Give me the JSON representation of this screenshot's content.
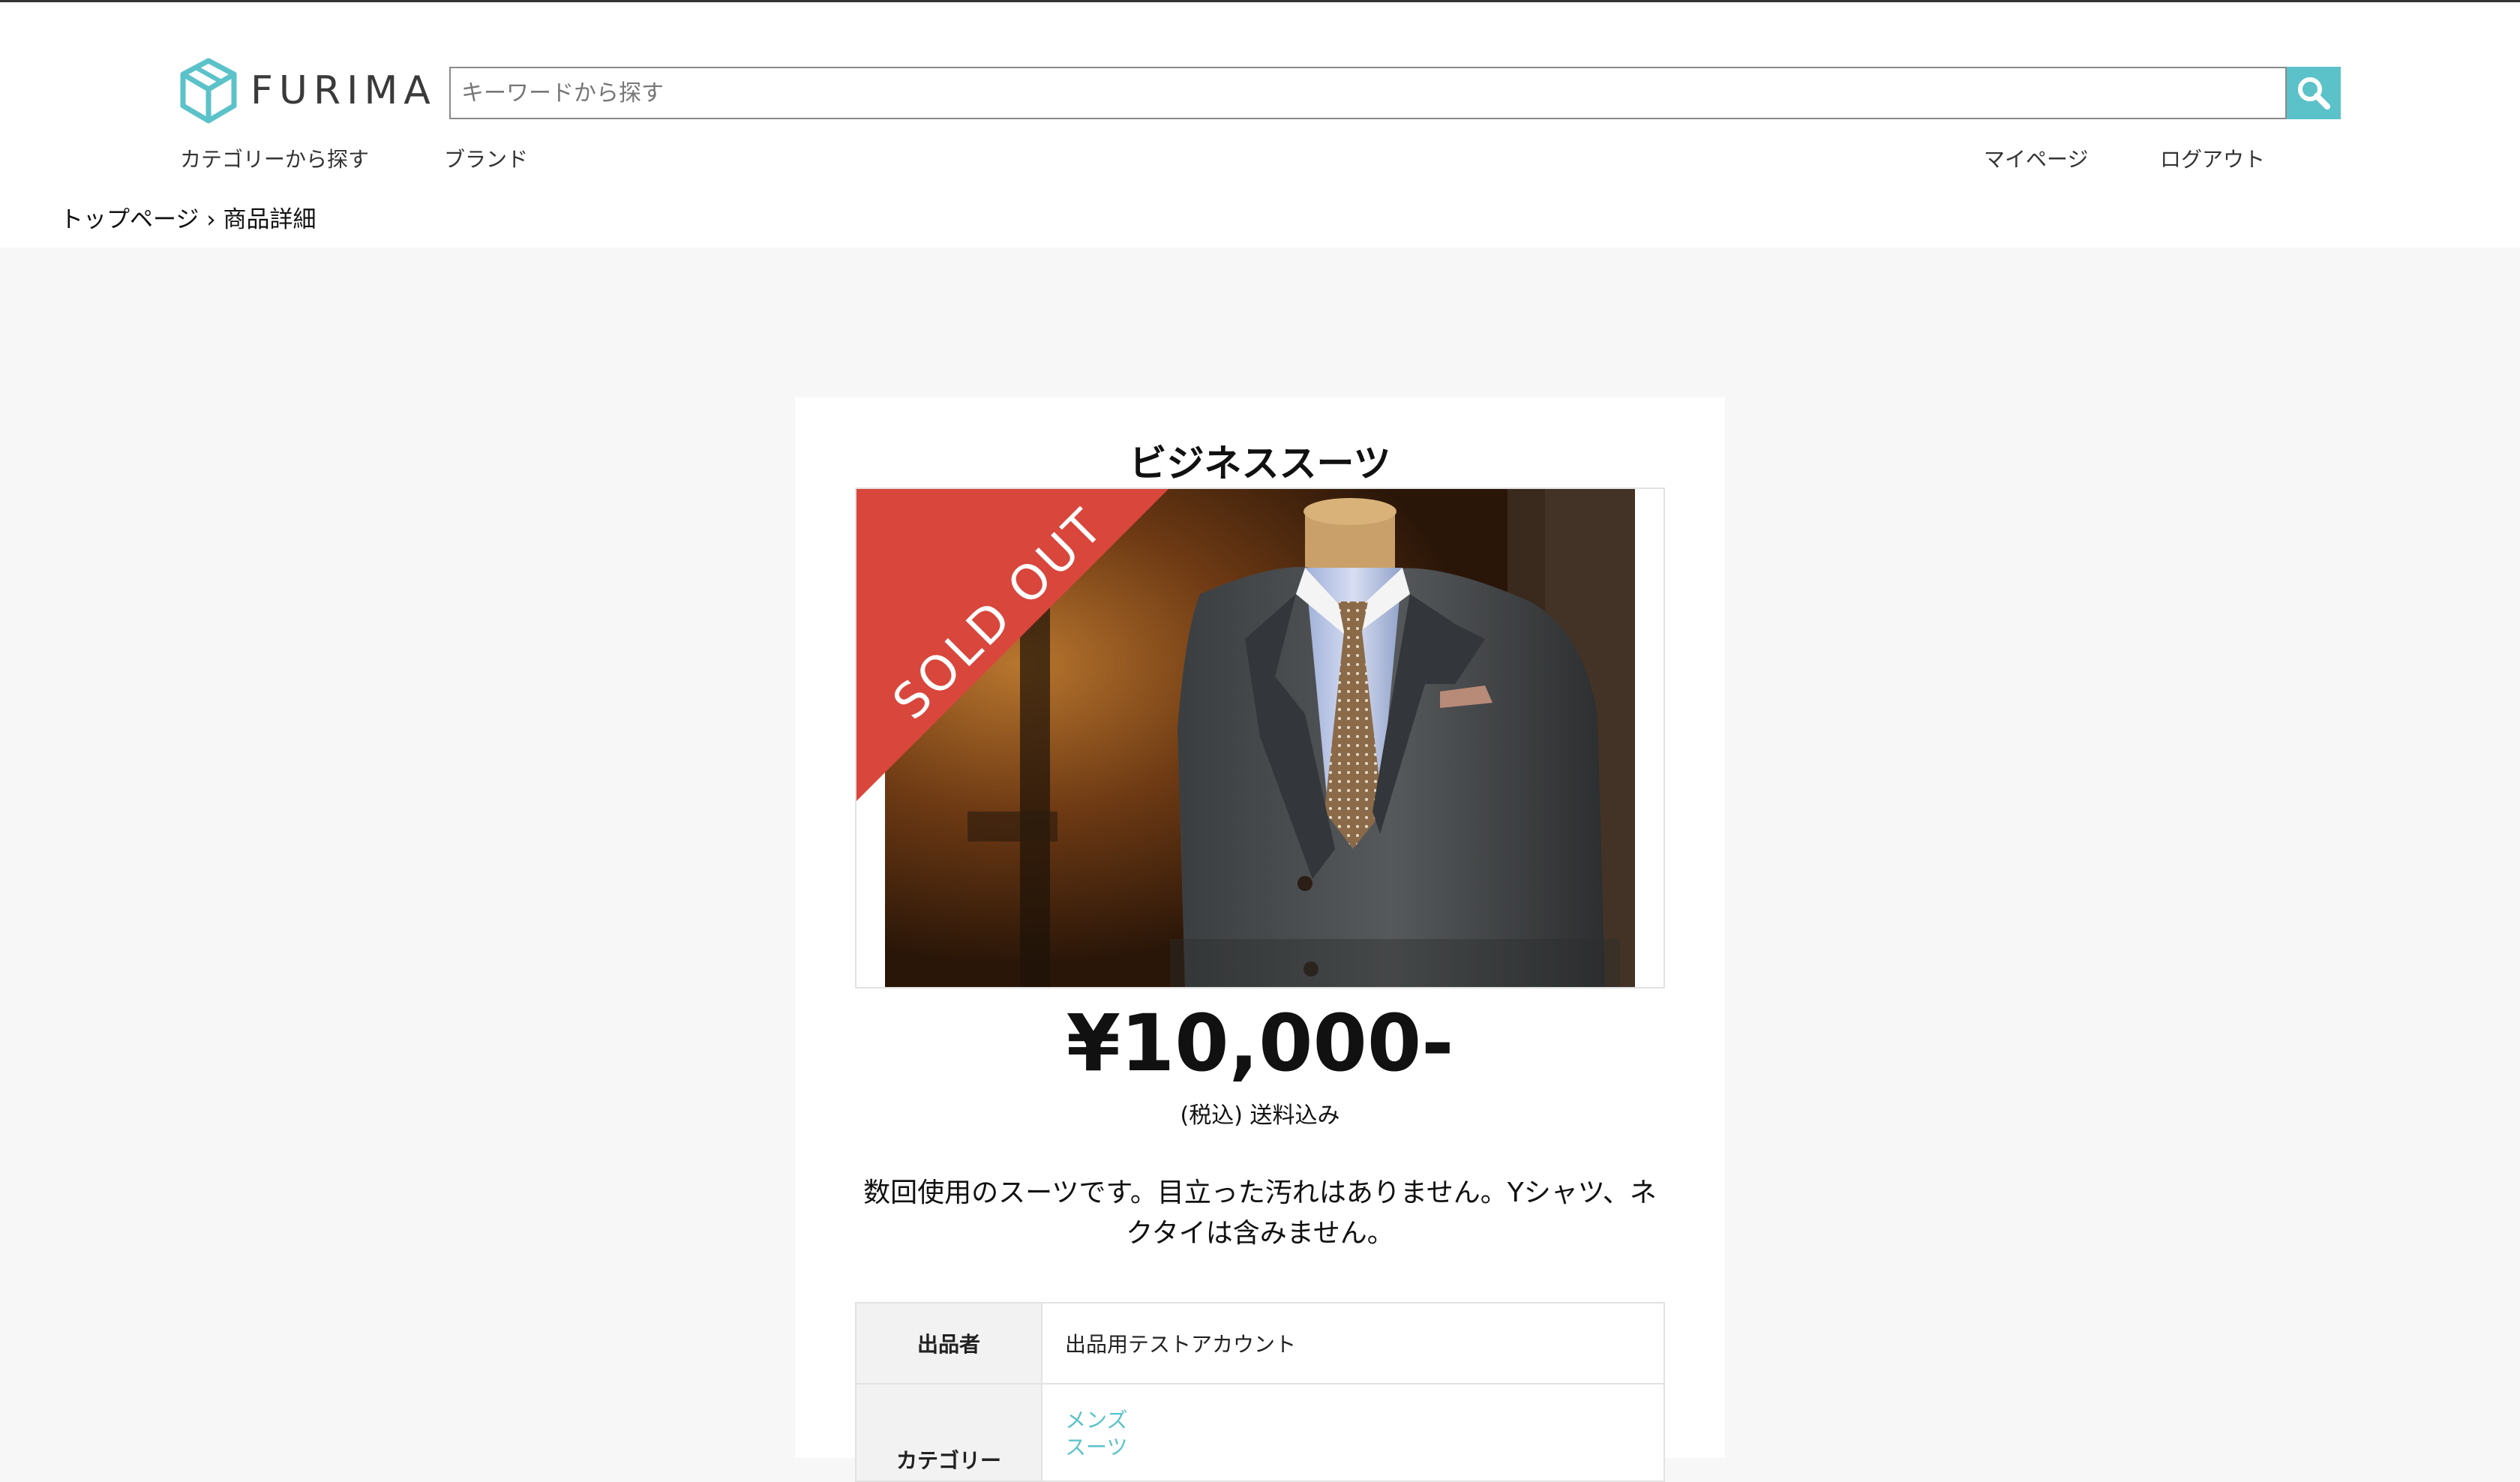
{
  "header": {
    "logo_text": "FURIMA",
    "search": {
      "placeholder": "キーワードから探す",
      "value": "",
      "button_icon": "search-icon"
    },
    "nav_left": [
      "カテゴリーから探す",
      "ブランド"
    ],
    "nav_right": [
      "マイページ",
      "ログアウト"
    ]
  },
  "breadcrumb": "トップページ › 商品詳細",
  "item": {
    "title": "ビジネススーツ",
    "sold_label": "SOLD OUT",
    "price": "¥10,000-",
    "price_note": "(税込) 送料込み",
    "description": "数回使用のスーツです。目立った汚れはありません。Yシャツ、ネクタイは含みません。",
    "details": {
      "seller_label": "出品者",
      "seller_value": "出品用テストアカウント",
      "category_label": "カテゴリー",
      "categories": [
        "メンズ",
        "スーツ"
      ]
    }
  },
  "colors": {
    "accent": "#5bc2c9",
    "sold_ribbon": "#d9463c",
    "background": "#f7f7f7"
  }
}
